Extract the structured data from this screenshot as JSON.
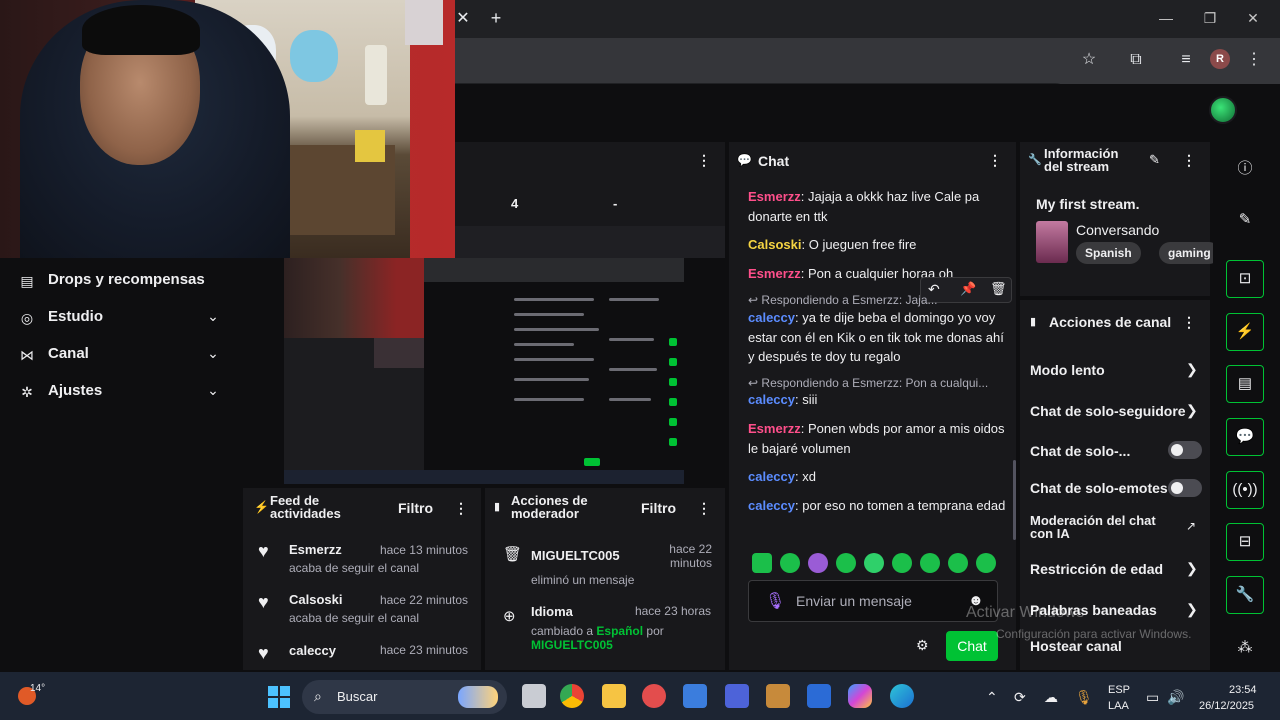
{
  "sidebar": {
    "items": [
      {
        "label": "Drops y recompensas",
        "icon": "gift-icon"
      },
      {
        "label": "Estudio",
        "icon": "studio-icon"
      },
      {
        "label": "Canal",
        "icon": "channel-icon"
      },
      {
        "label": "Ajustes",
        "icon": "gear-icon"
      }
    ]
  },
  "stats": {
    "value_a": "4",
    "value_b": "-"
  },
  "chat": {
    "title": "Chat",
    "messages": [
      {
        "user": "Esmerzz",
        "color": "#ff4f8b",
        "text": "Jajaja a okkk haz live Cale pa donarte en ttk"
      },
      {
        "user": "Calsoski",
        "color": "#f5d442",
        "text": "O jueguen free fire"
      },
      {
        "user": "Esmerzz",
        "color": "#ff4f8b",
        "text": "Pon a cualquier horaa oh"
      },
      {
        "reply": "Respondiendo a Esmerzz: Jaja...",
        "user": "caleccy",
        "color": "#5b8cff",
        "text": "ya te dije beba el domingo yo voy estar con él en Kik o en tik tok me donas ahí y después te doy tu regalo"
      },
      {
        "reply": "Respondiendo a Esmerzz: Pon a cualqui...",
        "user": "caleccy",
        "color": "#5b8cff",
        "text": "siii"
      },
      {
        "user": "Esmerzz",
        "color": "#ff4f8b",
        "text": "Ponen wbds por amor a mis oidos le bajaré volumen"
      },
      {
        "user": "caleccy",
        "color": "#5b8cff",
        "text": "xd"
      },
      {
        "user": "caleccy",
        "color": "#5b8cff",
        "text": "por eso no tomen a temprana edad"
      }
    ],
    "input_placeholder": "Enviar un mensaje",
    "send_label": "Chat"
  },
  "stream_info": {
    "title": "Información del stream",
    "stream_title": "My first stream.",
    "category": "Conversando",
    "tags": [
      "Spanish",
      "gaming"
    ]
  },
  "channel_actions": {
    "title": "Acciones de canal",
    "items": [
      {
        "label": "Modo lento",
        "control": "chevron"
      },
      {
        "label": "Chat de solo-seguidore",
        "control": "chevron"
      },
      {
        "label": "Chat de solo-...",
        "control": "toggle"
      },
      {
        "label": "Chat de solo-emotes",
        "control": "toggle"
      },
      {
        "label": "Moderación del chat con IA",
        "control": "external"
      },
      {
        "label": "Restricción de edad",
        "control": "chevron"
      },
      {
        "label": "Palabras baneadas",
        "control": "chevron"
      },
      {
        "label": "Hostear canal",
        "control": "none"
      }
    ]
  },
  "activity_feed": {
    "title": "Feed de actividades",
    "filter_label": "Filtro",
    "items": [
      {
        "name": "Esmerzz",
        "sub": "acaba de seguir el canal",
        "time": "hace 13 minutos"
      },
      {
        "name": "Calsoski",
        "sub": "acaba de seguir el canal",
        "time": "hace 22 minutos"
      },
      {
        "name": "caleccy",
        "sub": "",
        "time": "hace 23 minutos"
      }
    ]
  },
  "mod_actions": {
    "title": "Acciones de moderador",
    "filter_label": "Filtro",
    "items": [
      {
        "name": "MIGUELTC005",
        "sub": "eliminó un mensaje",
        "time": "hace 22 minutos",
        "icon": "trash-icon"
      },
      {
        "name": "Idioma",
        "sub_prefix": "cambiado a",
        "sub_highlight": "Español",
        "sub_mid": "por",
        "sub_user": "MIGUELTC005",
        "time": "hace 23 horas",
        "icon": "globe-icon"
      }
    ]
  },
  "taskbar": {
    "weather": "14°",
    "search_label": "Buscar",
    "lang": "ESP",
    "lang2": "LAA",
    "time": "23:54",
    "date": "26/12/2025"
  },
  "watermark": {
    "line1": "Activar Windows",
    "line2": "Configuración para activar Windows."
  },
  "browser": {
    "profile_initial": "R"
  },
  "colors": {
    "accent": "#00c234",
    "panel": "#18181b",
    "bg": "#0e0e10"
  }
}
